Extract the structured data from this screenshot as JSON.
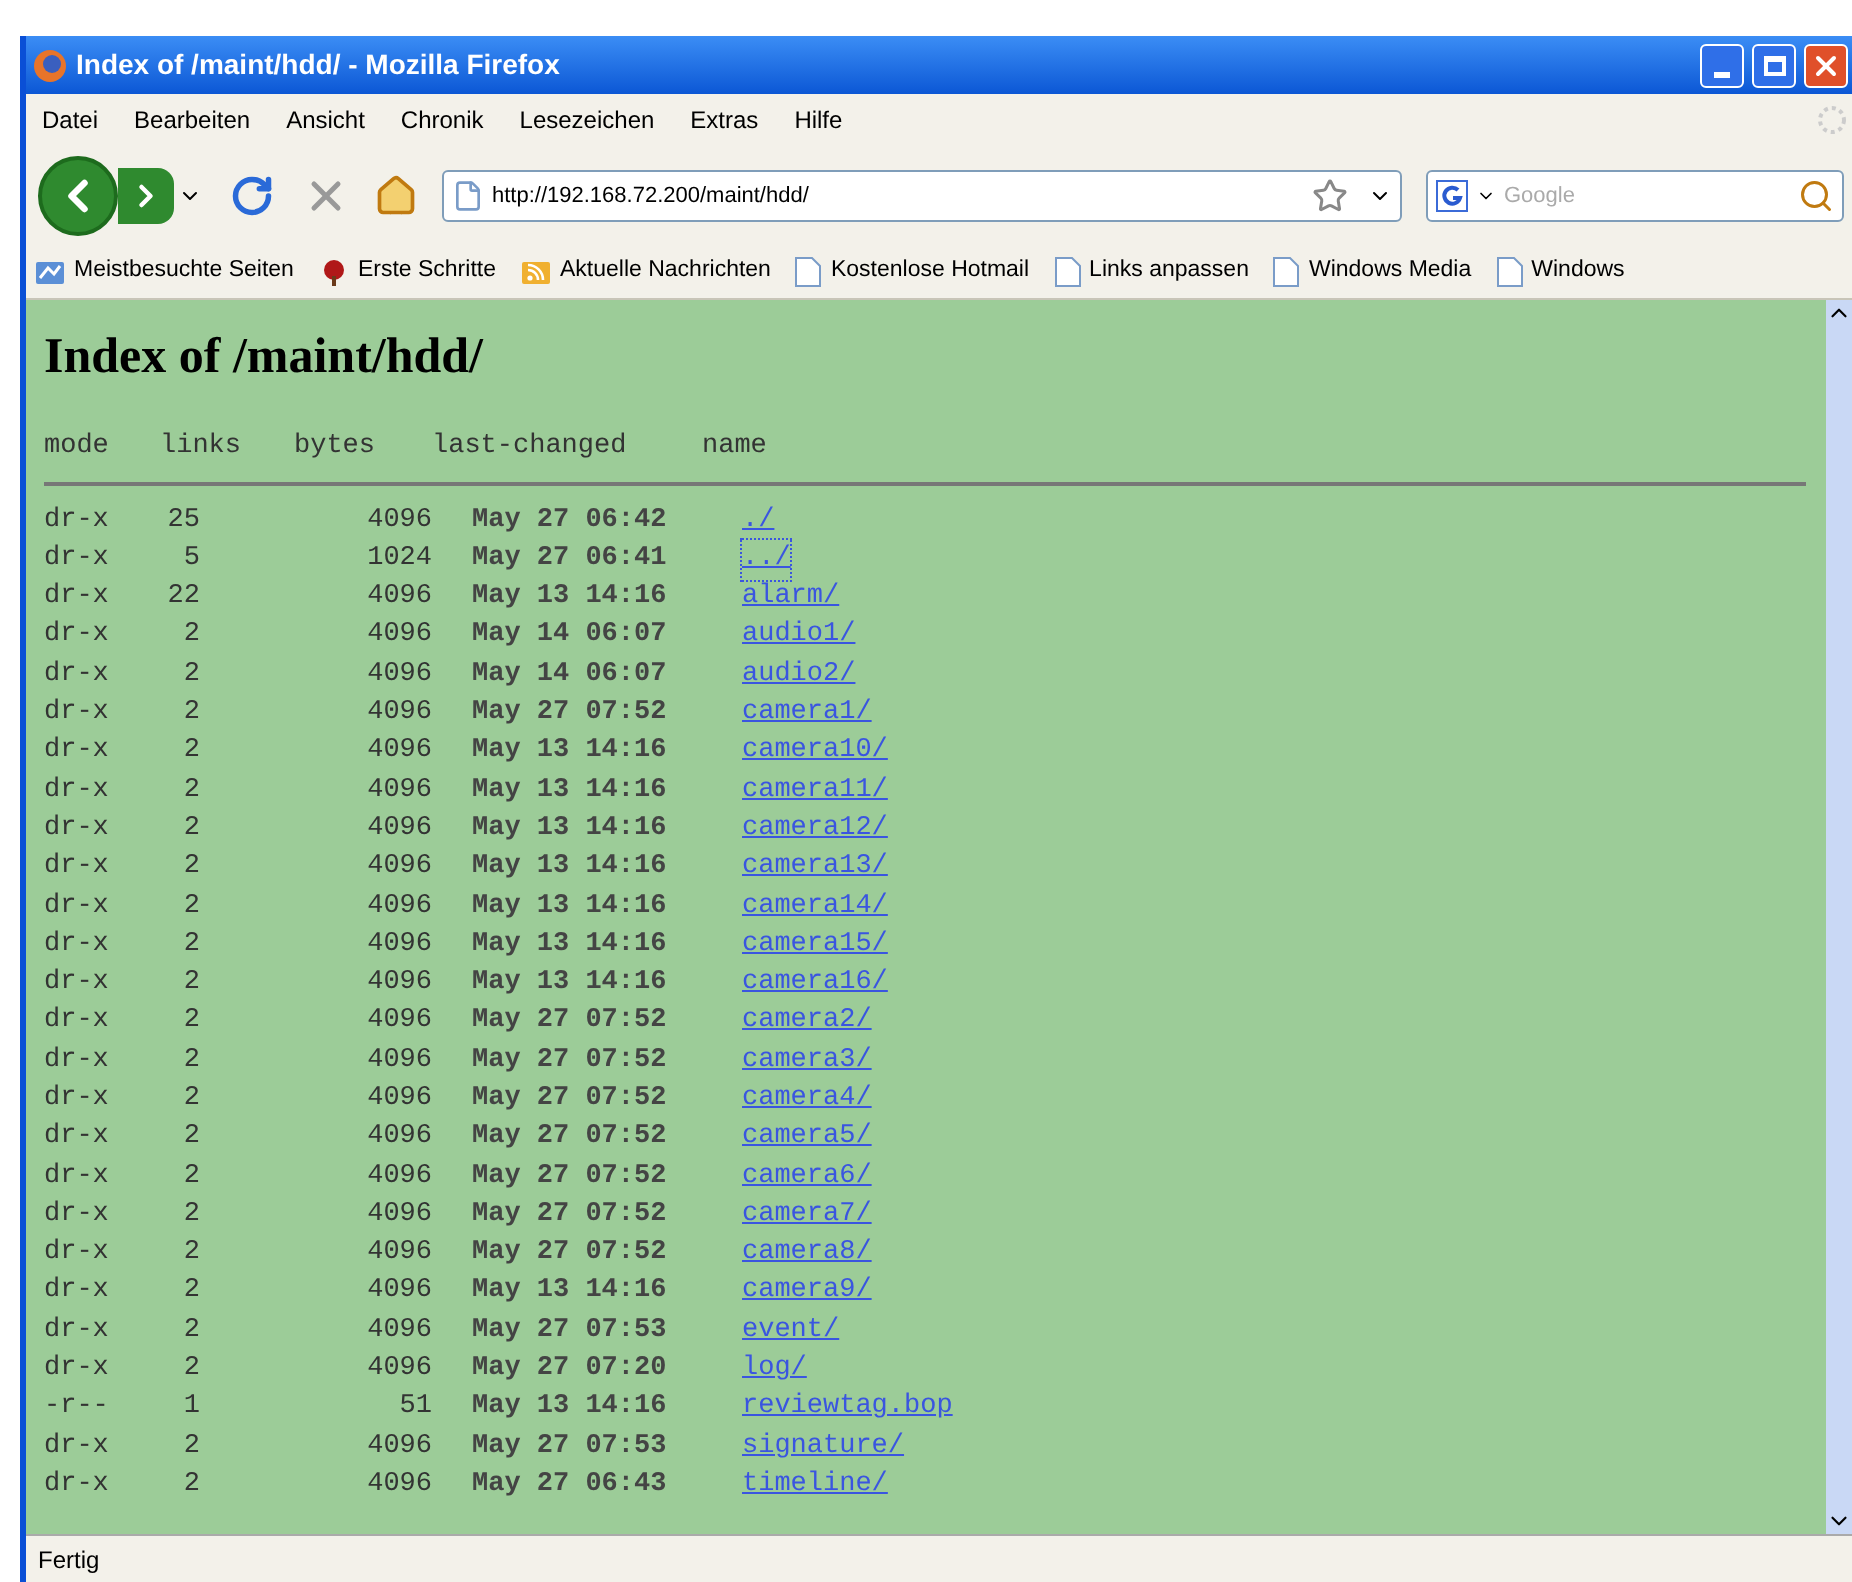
{
  "window": {
    "title": "Index of /maint/hdd/ - Mozilla Firefox"
  },
  "menu": [
    "Datei",
    "Bearbeiten",
    "Ansicht",
    "Chronik",
    "Lesezeichen",
    "Extras",
    "Hilfe"
  ],
  "address": {
    "value": "http://192.168.72.200/maint/hdd/"
  },
  "search": {
    "placeholder": "Google"
  },
  "bookmarks": [
    {
      "label": "Meistbesuchte Seiten",
      "kind": "smart"
    },
    {
      "label": "Erste Schritte",
      "kind": "start"
    },
    {
      "label": "Aktuelle Nachrichten",
      "kind": "feed"
    },
    {
      "label": "Kostenlose Hotmail",
      "kind": "page"
    },
    {
      "label": "Links anpassen",
      "kind": "page"
    },
    {
      "label": "Windows Media",
      "kind": "page"
    },
    {
      "label": "Windows",
      "kind": "page"
    }
  ],
  "page": {
    "heading": "Index of /maint/hdd/",
    "columns": [
      "mode",
      "links",
      "bytes",
      "last-changed",
      "name"
    ],
    "rows": [
      {
        "mode": "dr-x",
        "links": "25",
        "bytes": "4096",
        "changed": "May 27 06:42",
        "name": "./",
        "focused": false
      },
      {
        "mode": "dr-x",
        "links": "5",
        "bytes": "1024",
        "changed": "May 27 06:41",
        "name": "../",
        "focused": true
      },
      {
        "mode": "dr-x",
        "links": "22",
        "bytes": "4096",
        "changed": "May 13 14:16",
        "name": "alarm/",
        "focused": false
      },
      {
        "mode": "dr-x",
        "links": "2",
        "bytes": "4096",
        "changed": "May 14 06:07",
        "name": "audio1/",
        "focused": false
      },
      {
        "mode": "dr-x",
        "links": "2",
        "bytes": "4096",
        "changed": "May 14 06:07",
        "name": "audio2/",
        "focused": false
      },
      {
        "mode": "dr-x",
        "links": "2",
        "bytes": "4096",
        "changed": "May 27 07:52",
        "name": "camera1/",
        "focused": false
      },
      {
        "mode": "dr-x",
        "links": "2",
        "bytes": "4096",
        "changed": "May 13 14:16",
        "name": "camera10/",
        "focused": false
      },
      {
        "mode": "dr-x",
        "links": "2",
        "bytes": "4096",
        "changed": "May 13 14:16",
        "name": "camera11/",
        "focused": false
      },
      {
        "mode": "dr-x",
        "links": "2",
        "bytes": "4096",
        "changed": "May 13 14:16",
        "name": "camera12/",
        "focused": false
      },
      {
        "mode": "dr-x",
        "links": "2",
        "bytes": "4096",
        "changed": "May 13 14:16",
        "name": "camera13/",
        "focused": false
      },
      {
        "mode": "dr-x",
        "links": "2",
        "bytes": "4096",
        "changed": "May 13 14:16",
        "name": "camera14/",
        "focused": false
      },
      {
        "mode": "dr-x",
        "links": "2",
        "bytes": "4096",
        "changed": "May 13 14:16",
        "name": "camera15/",
        "focused": false
      },
      {
        "mode": "dr-x",
        "links": "2",
        "bytes": "4096",
        "changed": "May 13 14:16",
        "name": "camera16/",
        "focused": false
      },
      {
        "mode": "dr-x",
        "links": "2",
        "bytes": "4096",
        "changed": "May 27 07:52",
        "name": "camera2/",
        "focused": false
      },
      {
        "mode": "dr-x",
        "links": "2",
        "bytes": "4096",
        "changed": "May 27 07:52",
        "name": "camera3/",
        "focused": false
      },
      {
        "mode": "dr-x",
        "links": "2",
        "bytes": "4096",
        "changed": "May 27 07:52",
        "name": "camera4/",
        "focused": false
      },
      {
        "mode": "dr-x",
        "links": "2",
        "bytes": "4096",
        "changed": "May 27 07:52",
        "name": "camera5/",
        "focused": false
      },
      {
        "mode": "dr-x",
        "links": "2",
        "bytes": "4096",
        "changed": "May 27 07:52",
        "name": "camera6/",
        "focused": false
      },
      {
        "mode": "dr-x",
        "links": "2",
        "bytes": "4096",
        "changed": "May 27 07:52",
        "name": "camera7/",
        "focused": false
      },
      {
        "mode": "dr-x",
        "links": "2",
        "bytes": "4096",
        "changed": "May 27 07:52",
        "name": "camera8/",
        "focused": false
      },
      {
        "mode": "dr-x",
        "links": "2",
        "bytes": "4096",
        "changed": "May 13 14:16",
        "name": "camera9/",
        "focused": false
      },
      {
        "mode": "dr-x",
        "links": "2",
        "bytes": "4096",
        "changed": "May 27 07:53",
        "name": "event/",
        "focused": false
      },
      {
        "mode": "dr-x",
        "links": "2",
        "bytes": "4096",
        "changed": "May 27 07:20",
        "name": "log/",
        "focused": false
      },
      {
        "mode": "-r--",
        "links": "1",
        "bytes": "51",
        "changed": "May 13 14:16",
        "name": "reviewtag.bop",
        "focused": false
      },
      {
        "mode": "dr-x",
        "links": "2",
        "bytes": "4096",
        "changed": "May 27 07:53",
        "name": "signature/",
        "focused": false
      },
      {
        "mode": "dr-x",
        "links": "2",
        "bytes": "4096",
        "changed": "May 27 06:43",
        "name": "timeline/",
        "focused": false
      }
    ]
  },
  "status_bar": "Fertig"
}
